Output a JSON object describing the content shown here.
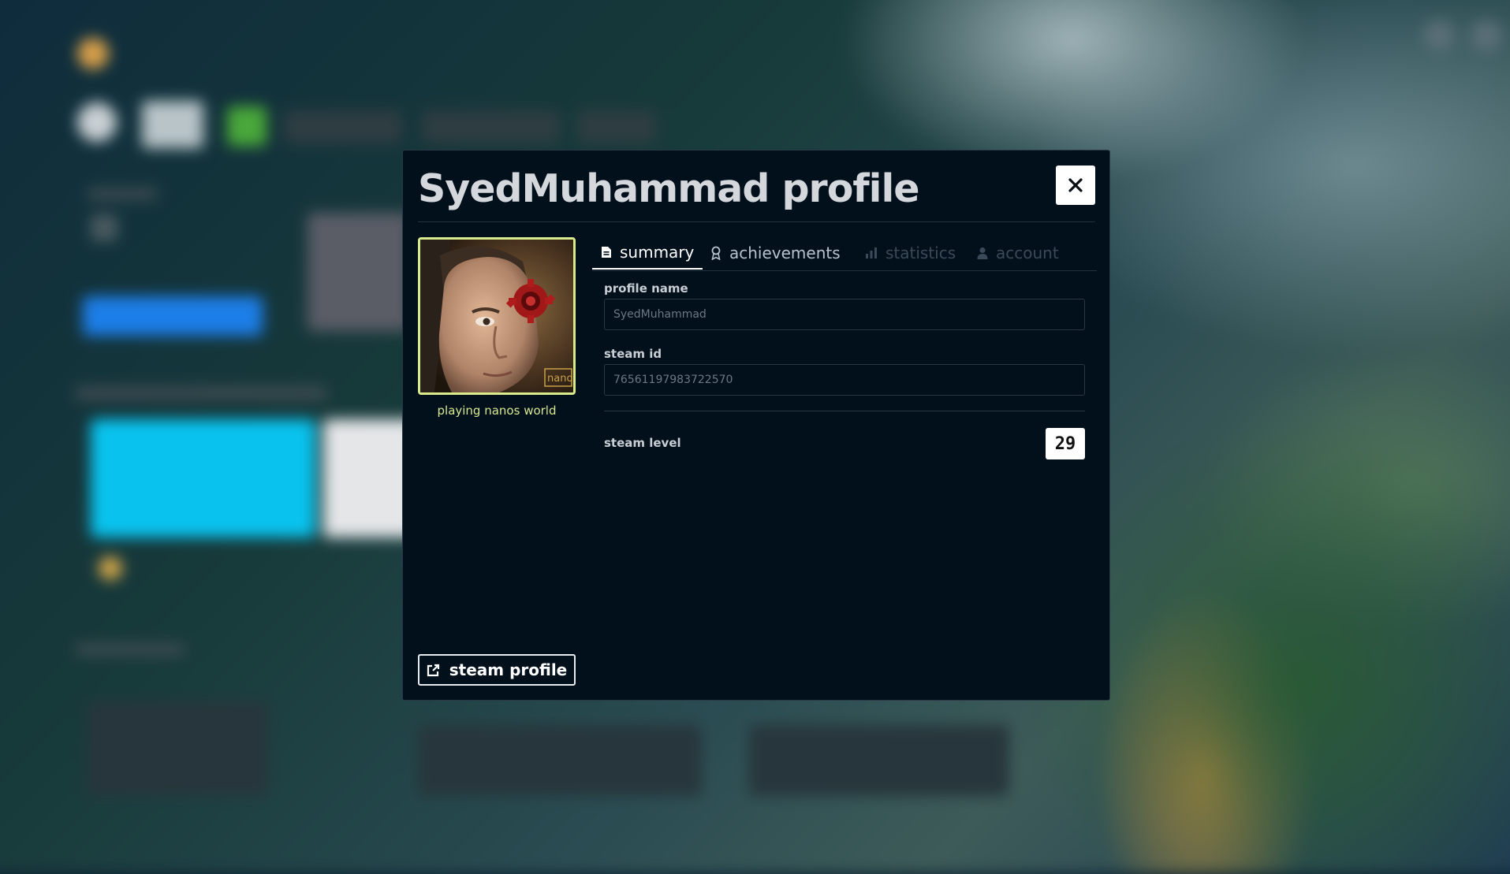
{
  "modal": {
    "title": "SyedMuhammad profile",
    "close_icon": "close-icon",
    "status": "playing nanos world",
    "avatar_watermark": "nano",
    "tabs": [
      {
        "label": "summary",
        "icon": "document-icon",
        "state": "active"
      },
      {
        "label": "achievements",
        "icon": "award-icon",
        "state": "normal"
      },
      {
        "label": "statistics",
        "icon": "bar-chart-icon",
        "state": "disabled"
      },
      {
        "label": "account",
        "icon": "user-icon",
        "state": "disabled"
      }
    ],
    "profile_name_label": "profile name",
    "profile_name_placeholder": "SyedMuhammad",
    "steam_id_label": "steam id",
    "steam_id_placeholder": "76561197983722570",
    "steam_level_label": "steam level",
    "steam_level_value": "29",
    "steam_profile_button": "steam profile"
  },
  "colors": {
    "modal_bg": "#02101c",
    "avatar_border": "#d9eb8c",
    "status_text": "#d8e890",
    "tab_disabled": "#3a4a58"
  }
}
